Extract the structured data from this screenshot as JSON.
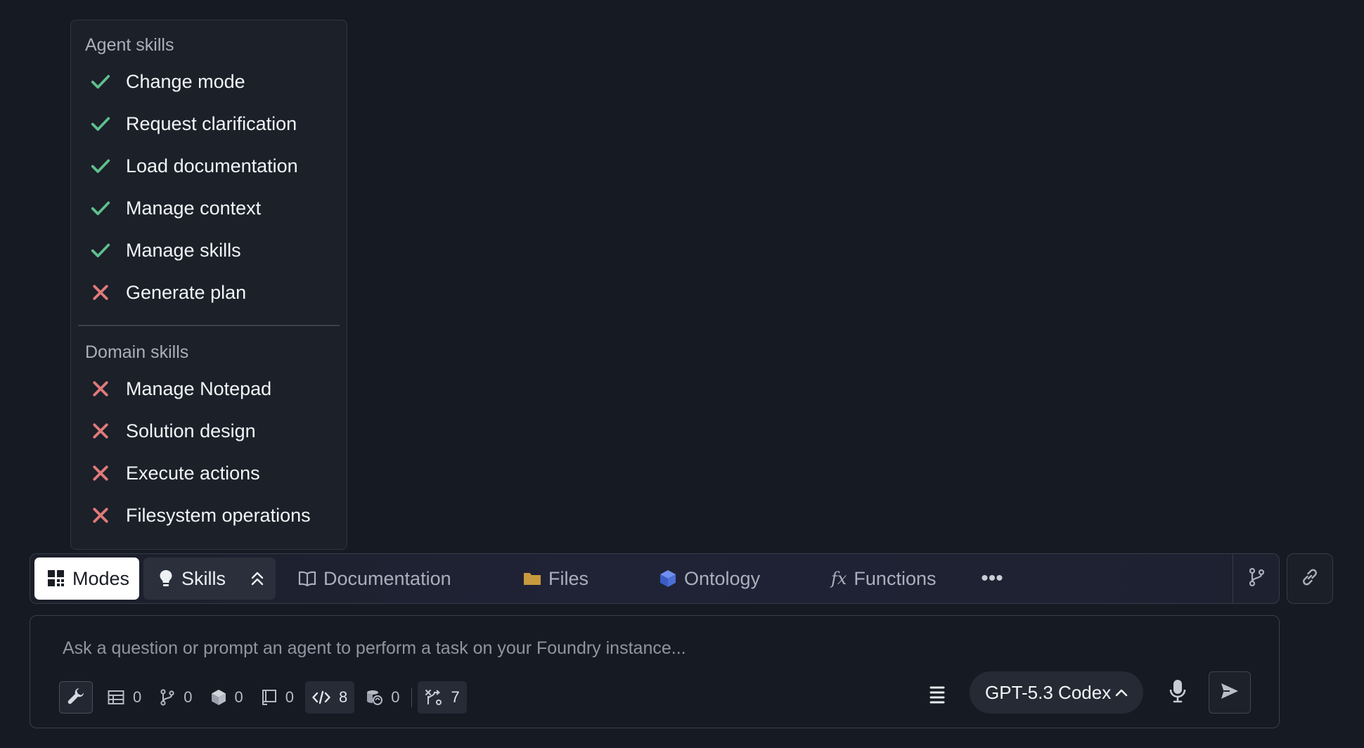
{
  "skills_popover": {
    "agent_heading": "Agent skills",
    "agent_skills": [
      {
        "label": "Change mode",
        "enabled": true
      },
      {
        "label": "Request clarification",
        "enabled": true
      },
      {
        "label": "Load documentation",
        "enabled": true
      },
      {
        "label": "Manage context",
        "enabled": true
      },
      {
        "label": "Manage skills",
        "enabled": true
      },
      {
        "label": "Generate plan",
        "enabled": false
      }
    ],
    "domain_heading": "Domain skills",
    "domain_skills": [
      {
        "label": "Manage Notepad",
        "enabled": false
      },
      {
        "label": "Solution design",
        "enabled": false
      },
      {
        "label": "Execute actions",
        "enabled": false
      },
      {
        "label": "Filesystem operations",
        "enabled": false
      }
    ]
  },
  "tabs": {
    "modes": "Modes",
    "skills": "Skills",
    "documentation": "Documentation",
    "files": "Files",
    "ontology": "Ontology",
    "functions": "Functions",
    "more": "•••"
  },
  "prompt": {
    "placeholder": "Ask a question or prompt an agent to perform a task on your Foundry instance...",
    "counters": {
      "tables": "0",
      "branches": "0",
      "objects": "0",
      "notebooks": "0",
      "code": "8",
      "datasets": "0",
      "actions": "7"
    },
    "model": "GPT-5.3 Codex"
  },
  "colors": {
    "background": "#161a22",
    "check": "#5fbf8e",
    "cross": "#e07a7a",
    "files_folder": "#c79a3e",
    "ontology_cube": "#4c6fd6"
  }
}
